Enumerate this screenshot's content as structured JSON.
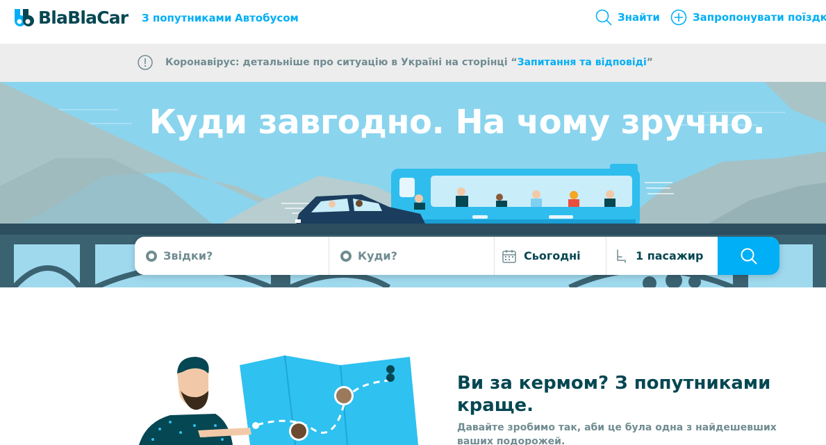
{
  "header": {
    "logo_text": "BlaBlaCar",
    "nav": [
      "З попутниками",
      "Автобусом"
    ],
    "search_label": "Знайти",
    "offer_label": "Запропонувати поїздку"
  },
  "banner": {
    "text": "Коронавірус: детальніше про ситуацію в Україні на сторінці “",
    "link": "Запитання та відповіді",
    "text_end": "”"
  },
  "hero": {
    "title": "Куди завгодно. На чому зручно."
  },
  "search": {
    "from_placeholder": "Звідки?",
    "to_placeholder": "Куди?",
    "date_value": "Сьогодні",
    "passengers_value": "1 пасажир"
  },
  "promo": {
    "title": "Ви за кермом? З попутниками краще.",
    "subtitle": "Давайте зробимо так, аби це була одна з найдешевших ваших подорожей."
  },
  "colors": {
    "brand": "#00aff5",
    "text_dark": "#054752",
    "text_muted": "#708c91",
    "banner_bg": "#ededed"
  },
  "icons": [
    "blablacar-logo-icon",
    "search-icon",
    "plus-circle-icon",
    "info-icon",
    "calendar-icon",
    "seat-icon"
  ]
}
